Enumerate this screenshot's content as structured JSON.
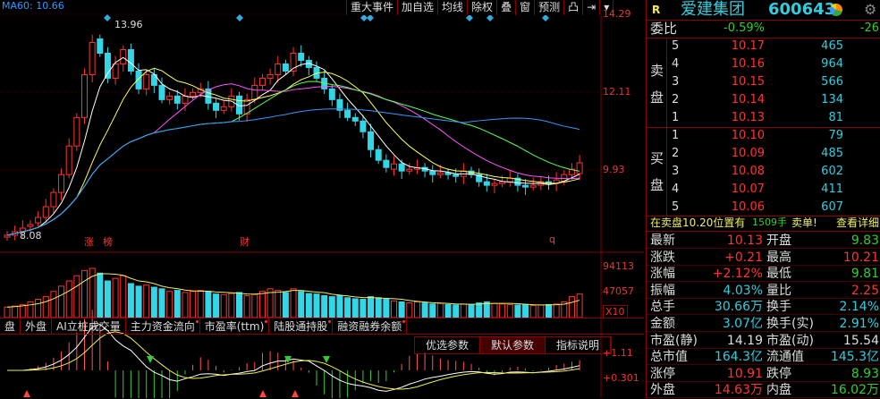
{
  "ma60_label": "MA60: 10.66",
  "toolbar": [
    "重大事件",
    "加自选",
    "均线",
    "除权",
    "叠",
    "窗",
    "预测",
    "凸",
    "⇥",
    "▾"
  ],
  "price_axis": [
    "14.29",
    "12.11",
    "9.93"
  ],
  "high_label": "13.96",
  "low_label": "8.08",
  "event_markers": [
    "涨",
    "榜",
    "财",
    "q"
  ],
  "volume_axis": [
    "94113",
    "47057",
    "X10"
  ],
  "indicator_tabs": [
    {
      "label": "盘",
      "dot": false
    },
    {
      "label": "外盘",
      "dot": false
    },
    {
      "label": "AI立桩成交量",
      "dot": false
    },
    {
      "label": "主力资金流向",
      "dot": true
    },
    {
      "label": "市盈率(ttm)",
      "dot": true
    },
    {
      "label": "陆股通持股",
      "dot": true
    },
    {
      "label": "融资融券余额",
      "dot": true
    }
  ],
  "param_buttons": [
    "优选参数",
    "默认参数",
    "指标说明"
  ],
  "macd_axis": [
    "+1.11",
    "+0.301"
  ],
  "colors": {
    "up": "#ff3333",
    "down": "#33d6e6",
    "ma5": "#ffffff",
    "ma10": "#ffff55",
    "ma20": "#ff55ff",
    "ma30": "#55ff55",
    "ma60": "#3399ff"
  },
  "price_data": {
    "opens": [
      8.05,
      8.1,
      8.2,
      8.35,
      8.45,
      8.6,
      8.9,
      9.3,
      9.8,
      10.6,
      11.4,
      12.6,
      13.6,
      13.2,
      12.5,
      12.9,
      13.3,
      12.7,
      12.2,
      12.6,
      12.3,
      11.9,
      12.0,
      11.8,
      12.0,
      12.1,
      12.2,
      11.8,
      11.6,
      11.7,
      12.0,
      11.5,
      11.9,
      12.3,
      12.5,
      12.6,
      12.9,
      12.7,
      13.2,
      13.0,
      12.8,
      12.5,
      12.2,
      11.9,
      11.6,
      11.4,
      11.3,
      11.0,
      10.5,
      10.2,
      9.95,
      10.1,
      9.9,
      9.95,
      10.0,
      9.9,
      9.8,
      9.85,
      9.8,
      9.75,
      9.9,
      9.8,
      9.6,
      9.5,
      9.55,
      9.6,
      9.7,
      9.5,
      9.45,
      9.5,
      9.6,
      9.55,
      9.6,
      9.8,
      9.83
    ],
    "closes": [
      8.1,
      8.2,
      8.3,
      8.4,
      8.6,
      8.9,
      9.3,
      9.8,
      10.6,
      11.4,
      12.6,
      13.5,
      13.2,
      12.5,
      12.9,
      13.3,
      12.7,
      12.2,
      12.6,
      12.3,
      11.9,
      12.0,
      11.8,
      12.0,
      12.1,
      12.2,
      11.8,
      11.6,
      11.7,
      12.0,
      11.5,
      11.9,
      12.3,
      12.5,
      12.6,
      12.9,
      12.7,
      13.2,
      13.0,
      12.8,
      12.5,
      12.2,
      11.9,
      11.6,
      11.4,
      11.3,
      11.0,
      10.5,
      10.2,
      10.0,
      10.1,
      9.9,
      9.95,
      10.0,
      9.9,
      9.8,
      9.85,
      9.8,
      9.75,
      9.9,
      9.8,
      9.6,
      9.5,
      9.55,
      9.6,
      9.7,
      9.5,
      9.45,
      9.5,
      9.6,
      9.55,
      9.65,
      9.8,
      9.95,
      10.13
    ],
    "volumes": [
      20,
      22,
      25,
      30,
      35,
      40,
      50,
      60,
      70,
      80,
      90,
      94,
      85,
      70,
      75,
      80,
      65,
      60,
      62,
      58,
      55,
      50,
      52,
      48,
      50,
      52,
      50,
      45,
      44,
      46,
      48,
      42,
      44,
      50,
      55,
      52,
      48,
      55,
      50,
      46,
      45,
      42,
      40,
      42,
      38,
      36,
      35,
      40,
      38,
      35,
      32,
      30,
      28,
      30,
      28,
      26,
      27,
      25,
      24,
      26,
      25,
      28,
      30,
      27,
      26,
      25,
      24,
      25,
      23,
      24,
      25,
      26,
      30,
      40,
      45
    ]
  },
  "quote": {
    "market_flag": "R",
    "name": "爱建集团",
    "code": "600643",
    "weibi_label": "委比",
    "weibi_pct": "-0.59%",
    "weibi_diff": "-26",
    "sell_label": [
      "卖",
      "盘"
    ],
    "buy_label": [
      "买",
      "盘"
    ],
    "sell": [
      {
        "lvl": "5",
        "price": "10.17",
        "vol": "465"
      },
      {
        "lvl": "4",
        "price": "10.16",
        "vol": "964"
      },
      {
        "lvl": "3",
        "price": "10.15",
        "vol": "566"
      },
      {
        "lvl": "2",
        "price": "10.14",
        "vol": "134"
      },
      {
        "lvl": "1",
        "price": "10.13",
        "vol": "81"
      }
    ],
    "buy": [
      {
        "lvl": "1",
        "price": "10.10",
        "vol": "79"
      },
      {
        "lvl": "2",
        "price": "10.09",
        "vol": "485"
      },
      {
        "lvl": "3",
        "price": "10.08",
        "vol": "602"
      },
      {
        "lvl": "4",
        "price": "10.07",
        "vol": "411"
      },
      {
        "lvl": "5",
        "price": "10.06",
        "vol": "607"
      }
    ],
    "notice_pre": "在卖盘10.20位置有",
    "notice_vol": "1509手",
    "notice_post": "卖单!",
    "notice_link": "查看详细",
    "stats": [
      {
        "l1": "最新",
        "v1": "10.13",
        "c1": "red",
        "l2": "开盘",
        "v2": "9.83",
        "c2": "grn"
      },
      {
        "l1": "涨跌",
        "v1": "+0.21",
        "c1": "red",
        "l2": "最高",
        "v2": "10.21",
        "c2": "red"
      },
      {
        "l1": "涨幅",
        "v1": "+2.12%",
        "c1": "red",
        "l2": "最低",
        "v2": "9.81",
        "c2": "grn"
      },
      {
        "l1": "振幅",
        "v1": "4.03%",
        "c1": "cyan",
        "l2": "量比",
        "v2": "2.25",
        "c2": "red"
      },
      {
        "l1": "总手",
        "v1": "30.66万",
        "c1": "cyan",
        "l2": "换手",
        "v2": "2.14%",
        "c2": "cyan"
      },
      {
        "l1": "金额",
        "v1": "3.07亿",
        "c1": "cyan",
        "l2": "换手(实)",
        "v2": "2.91%",
        "c2": "cyan"
      },
      {
        "l1": "市盈(静)",
        "v1": "14.19",
        "c1": "wht",
        "l2": "市盈(动)",
        "v2": "15.54",
        "c2": "wht"
      },
      {
        "l1": "总市值",
        "v1": "164.3亿",
        "c1": "cyan",
        "l2": "流通值",
        "v2": "145.3亿",
        "c2": "cyan"
      },
      {
        "l1": "涨停",
        "v1": "10.91",
        "c1": "red",
        "l2": "跌停",
        "v2": "8.93",
        "c2": "grn"
      },
      {
        "l1": "外盘",
        "v1": "14.63万",
        "c1": "red",
        "l2": "内盘",
        "v2": "16.02万",
        "c2": "grn"
      }
    ]
  }
}
